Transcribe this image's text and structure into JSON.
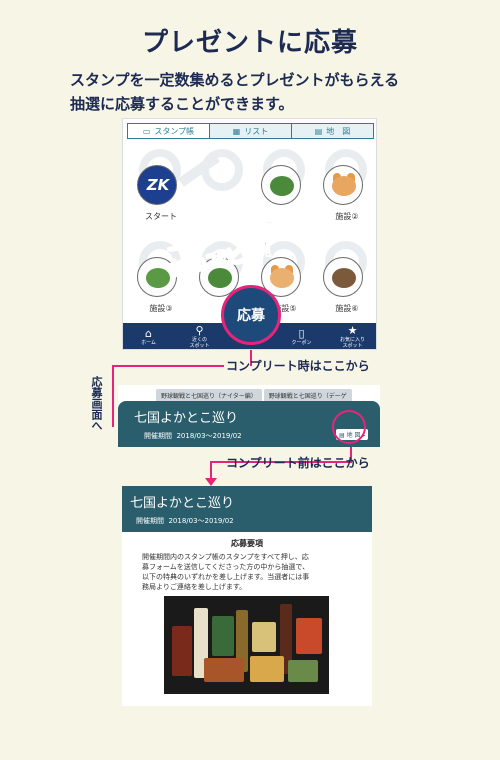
{
  "page": {
    "title": "プレゼントに応募",
    "description_lines": [
      "スタンプを一定数集めるとプレゼントがもらえる",
      "抽選に応募することができます。"
    ]
  },
  "stamp_screen": {
    "tabs": [
      {
        "label": "スタンプ帳",
        "icon": "book-icon"
      },
      {
        "label": "リスト",
        "icon": "list-icon"
      },
      {
        "label": "地　図",
        "icon": "map-icon"
      }
    ],
    "cells": [
      {
        "label": "スタート",
        "kind": "logo"
      },
      {
        "label": "",
        "kind": "leaf"
      },
      {
        "label": "",
        "kind": "leaf"
      },
      {
        "label": "施設②",
        "kind": "cat"
      },
      {
        "label": "施設③",
        "kind": "leaf"
      },
      {
        "label": "",
        "kind": "leaf"
      },
      {
        "label": "施設⑤",
        "kind": "cat"
      },
      {
        "label": "施設⑥",
        "kind": "bowl"
      }
    ],
    "banner_lines": [
      "スタンプ",
      "コンプリート",
      "おめでとう！"
    ],
    "logo_text": "ZK",
    "apply_button": "応募",
    "nav": [
      {
        "label": "ホーム",
        "icon": "home-icon"
      },
      {
        "label": "近くの\nスポット",
        "icon": "pin-icon"
      },
      {
        "label": "",
        "icon": "center-icon"
      },
      {
        "label": "クーポン",
        "icon": "coupon-icon"
      },
      {
        "label": "お気に入り\nスポット",
        "icon": "star-icon"
      }
    ]
  },
  "annotations": {
    "complete_label": "コンプリート時はここから",
    "before_label": "コンプリート前はここから",
    "vertical_label": "応募画面へ"
  },
  "event_tab_screen": {
    "tabs": [
      "野球観戦と七国巡り（ナイター編）",
      "野球観戦と七国巡り（デーゲ"
    ],
    "title": "七国よかとこ巡り",
    "period_label": "開催期間",
    "period": "2018/03〜2019/02",
    "map_button": "地 図"
  },
  "apply_screen": {
    "title": "七国よかとこ巡り",
    "period_label": "開催期間",
    "period": "2018/03〜2019/02",
    "section_title": "応募要項",
    "body_lines": [
      "開催期間内のスタンプ帳のスタンプをすべて押し、応",
      "募フォームを送信してくださった方の中から抽選で、",
      "以下の特典のいずれかを差し上げます。当選者には事",
      "務局よりご連絡を差し上げます。"
    ]
  },
  "colors": {
    "background": "#f7f6e6",
    "accent_pink": "#e8247a",
    "navy": "#1b3a6b",
    "teal": "#2a5e6c"
  }
}
